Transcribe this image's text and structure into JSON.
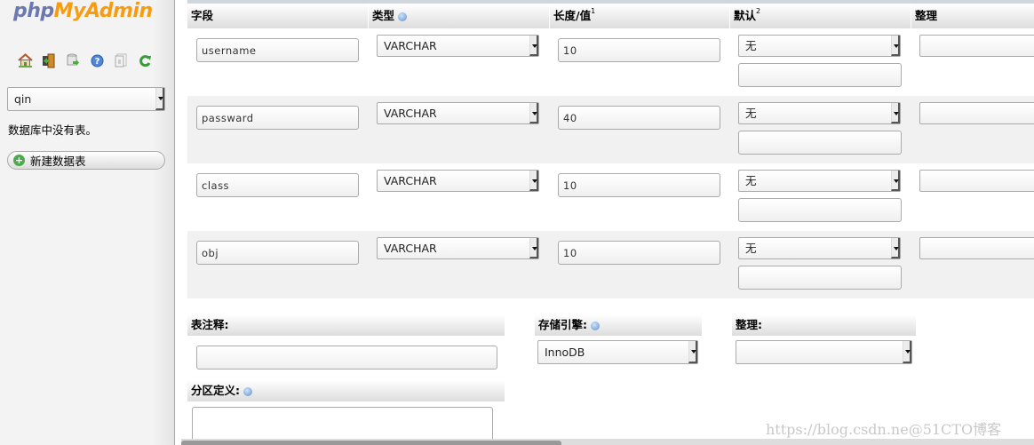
{
  "app": {
    "logo_part1": "php",
    "logo_part2": "MyAdmin"
  },
  "sidebar": {
    "nav_icons": [
      "home-icon",
      "logout-icon",
      "query-window-icon",
      "help-icon",
      "documentation-icon",
      "reload-icon"
    ],
    "database_select": {
      "value": "qin"
    },
    "no_tables_text": "数据库中没有表。",
    "new_table_button": "新建数据表"
  },
  "columns_table": {
    "headers": {
      "name": "字段",
      "type": "类型",
      "length": "长度/值",
      "length_sup": "1",
      "default": "默认",
      "default_sup": "2",
      "collation": "整理"
    },
    "rows": [
      {
        "name": "username",
        "type": "VARCHAR",
        "length": "10",
        "default": "无",
        "default_value": "",
        "collation": ""
      },
      {
        "name": "passward",
        "type": "VARCHAR",
        "length": "40",
        "default": "无",
        "default_value": "",
        "collation": ""
      },
      {
        "name": "class",
        "type": "VARCHAR",
        "length": "10",
        "default": "无",
        "default_value": "",
        "collation": ""
      },
      {
        "name": "obj",
        "type": "VARCHAR",
        "length": "10",
        "default": "无",
        "default_value": "",
        "collation": ""
      }
    ]
  },
  "table_options": {
    "comment_label": "表注释:",
    "comment_value": "",
    "engine_label": "存储引擎:",
    "engine_value": "InnoDB",
    "collation_label": "整理:",
    "collation_value": "",
    "partition_label": "分区定义:",
    "partition_value": ""
  },
  "watermark": "https://blog.csdn.ne@51CTO博客"
}
